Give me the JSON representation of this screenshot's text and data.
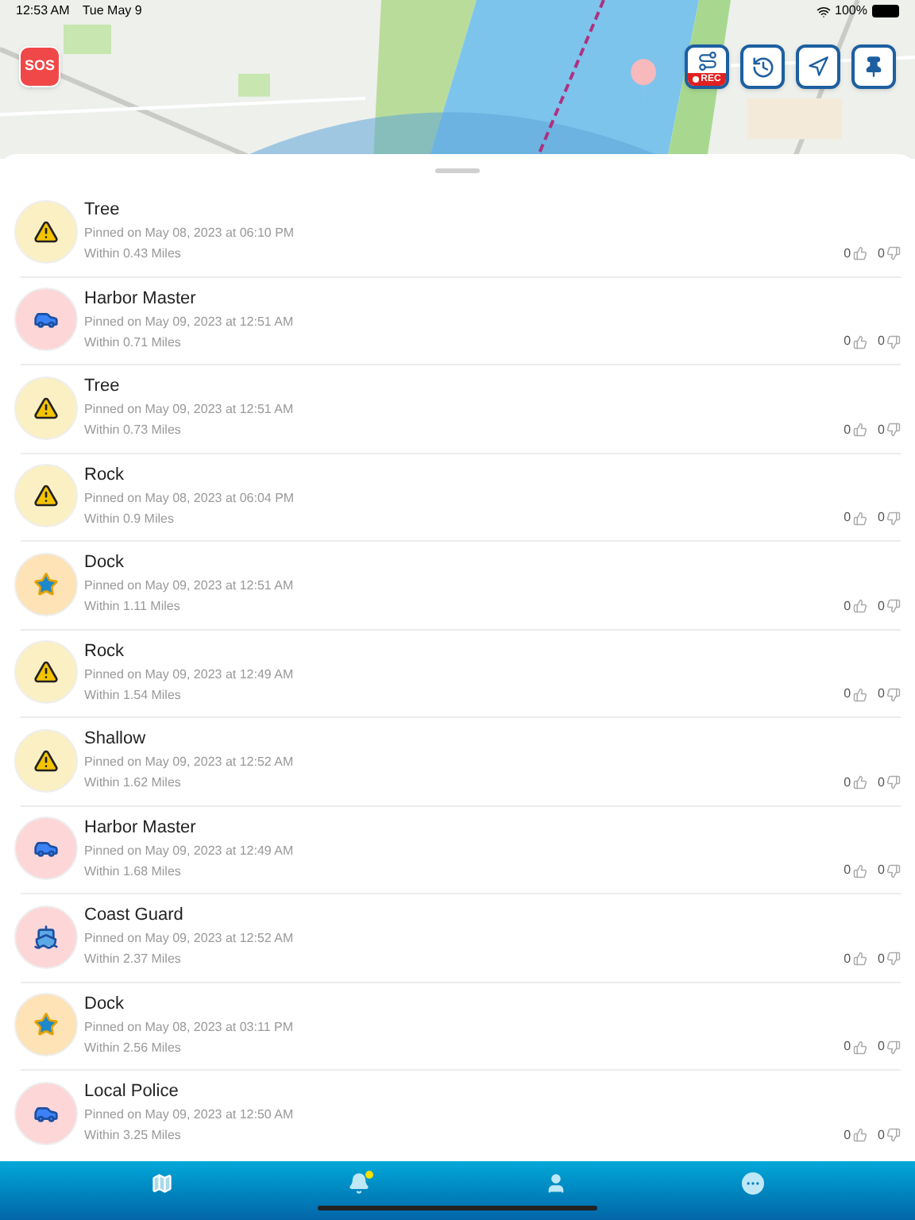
{
  "status_bar": {
    "time": "12:53 AM",
    "date": "Tue May 9",
    "battery": "100%"
  },
  "map": {
    "kind": "picture",
    "sos_label": "SOS",
    "rec_label": "REC"
  },
  "pins": [
    {
      "kind": "warning",
      "title": "Tree",
      "pinned": "Pinned on May 08, 2023 at 06:10 PM",
      "distance": "Within 0.43 Miles",
      "likes": "0",
      "dislikes": "0"
    },
    {
      "kind": "police",
      "title": "Harbor Master",
      "pinned": "Pinned on May 09, 2023 at 12:51 AM",
      "distance": "Within 0.71 Miles",
      "likes": "0",
      "dislikes": "0"
    },
    {
      "kind": "warning",
      "title": "Tree",
      "pinned": "Pinned on May 09, 2023 at 12:51 AM",
      "distance": "Within 0.73 Miles",
      "likes": "0",
      "dislikes": "0"
    },
    {
      "kind": "warning",
      "title": "Rock",
      "pinned": "Pinned on May 08, 2023 at 06:04 PM",
      "distance": "Within 0.9 Miles",
      "likes": "0",
      "dislikes": "0"
    },
    {
      "kind": "star",
      "title": "Dock",
      "pinned": "Pinned on May 09, 2023 at 12:51 AM",
      "distance": "Within 1.11 Miles",
      "likes": "0",
      "dislikes": "0"
    },
    {
      "kind": "warning",
      "title": "Rock",
      "pinned": "Pinned on May 09, 2023 at 12:49 AM",
      "distance": "Within 1.54 Miles",
      "likes": "0",
      "dislikes": "0"
    },
    {
      "kind": "warning",
      "title": "Shallow",
      "pinned": "Pinned on May 09, 2023 at 12:52 AM",
      "distance": "Within 1.62 Miles",
      "likes": "0",
      "dislikes": "0"
    },
    {
      "kind": "police",
      "title": "Harbor Master",
      "pinned": "Pinned on May 09, 2023 at 12:49 AM",
      "distance": "Within 1.68 Miles",
      "likes": "0",
      "dislikes": "0"
    },
    {
      "kind": "boat",
      "title": "Coast Guard",
      "pinned": "Pinned on May 09, 2023 at 12:52 AM",
      "distance": "Within 2.37 Miles",
      "likes": "0",
      "dislikes": "0"
    },
    {
      "kind": "star",
      "title": "Dock",
      "pinned": "Pinned on May 08, 2023 at 03:11 PM",
      "distance": "Within 2.56 Miles",
      "likes": "0",
      "dislikes": "0"
    },
    {
      "kind": "police",
      "title": "Local Police",
      "pinned": "Pinned on May 09, 2023 at 12:50 AM",
      "distance": "Within 3.25 Miles",
      "likes": "0",
      "dislikes": "0"
    }
  ],
  "tab_bar": {
    "alerts_unread": true
  }
}
